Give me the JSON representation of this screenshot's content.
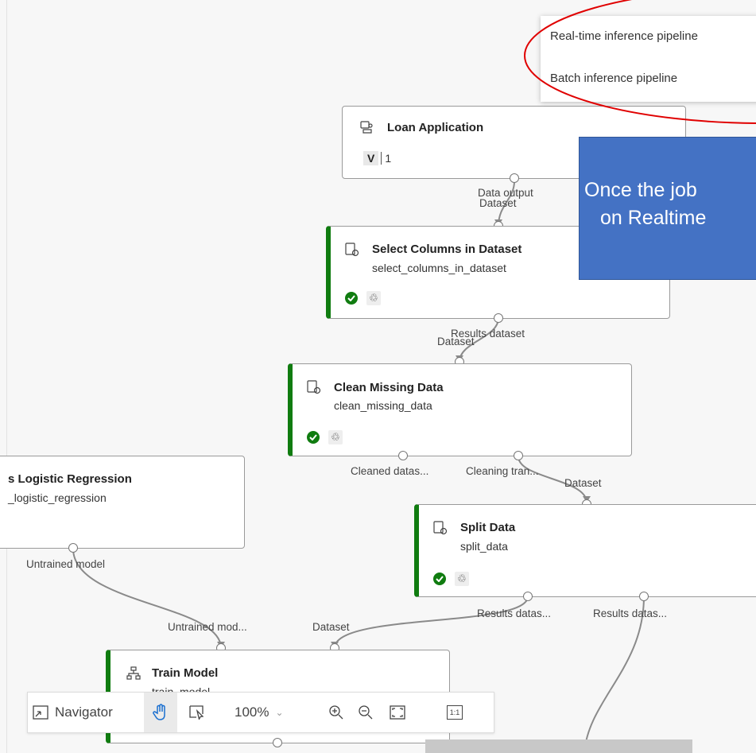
{
  "context_menu": {
    "items": [
      "Real-time inference pipeline",
      "Batch inference pipeline"
    ]
  },
  "callout": {
    "line1": "Once the job",
    "line2": "on Realtime"
  },
  "nodes": {
    "loan": {
      "title": "Loan Application",
      "version_label": "V",
      "version": "1",
      "port_out": "Data output"
    },
    "select": {
      "title": "Select Columns in Dataset",
      "name": "select_columns_in_dataset",
      "port_in": "Dataset",
      "port_out": "Results dataset"
    },
    "clean": {
      "title": "Clean Missing Data",
      "name": "clean_missing_data",
      "port_in": "Dataset",
      "port_out1": "Cleaned datas...",
      "port_out2": "Cleaning tran..."
    },
    "logistic": {
      "title": "s Logistic Regression",
      "name": "_logistic_regression",
      "port_out": "Untrained model"
    },
    "split": {
      "title": "Split Data",
      "name": "split_data",
      "port_in": "Dataset",
      "port_out1": "Results datas...",
      "port_out2": "Results datas..."
    },
    "train": {
      "title": "Train Model",
      "name": "train_model",
      "port_in1": "Untrained mod...",
      "port_in2": "Dataset"
    }
  },
  "toolbar": {
    "navigator_label": "Navigator",
    "zoom": "100%",
    "actual_size_label": "1:1"
  },
  "colors": {
    "success": "#107c10",
    "callout_fill": "#4472c4",
    "annotation_ellipse": "#e00000"
  }
}
